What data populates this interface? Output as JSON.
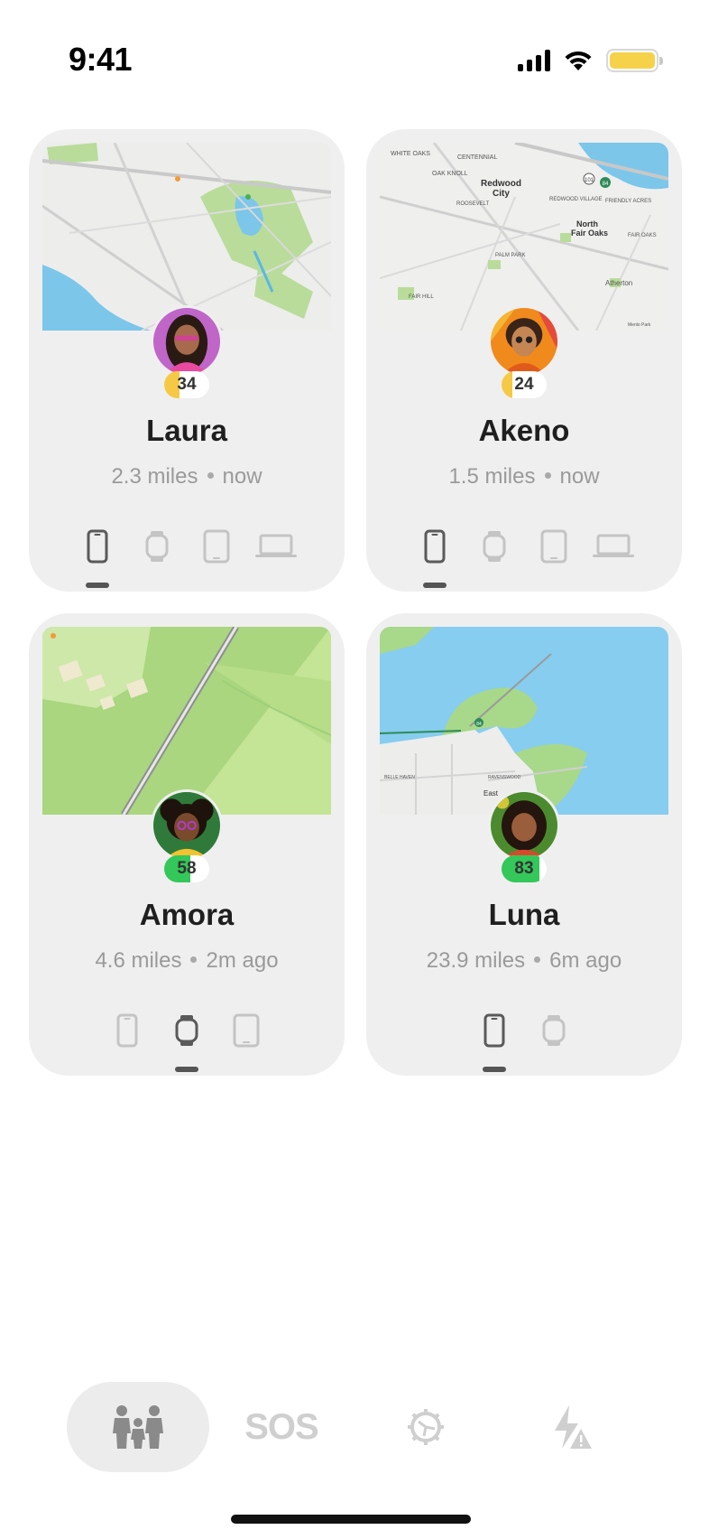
{
  "status_bar": {
    "time": "9:41"
  },
  "people": [
    {
      "name": "Laura",
      "distance": "2.3 miles",
      "last_seen": "now",
      "battery": "34",
      "battery_level": 0.34,
      "battery_color": "#f5c945",
      "map": "urban-bay",
      "avatar_bg": "#c066c8",
      "skin": "#a86a4c",
      "hair": "#2a1a14",
      "shirt": "#e94aa0",
      "devices": [
        {
          "icon": "phone-icon",
          "active": true
        },
        {
          "icon": "watch-icon",
          "active": false
        },
        {
          "icon": "tablet-icon",
          "active": false
        },
        {
          "icon": "laptop-icon",
          "active": false
        }
      ]
    },
    {
      "name": "Akeno",
      "distance": "1.5 miles",
      "last_seen": "now",
      "battery": "24",
      "battery_level": 0.24,
      "battery_color": "#f5c945",
      "map": "city-grid",
      "avatar_bg": "#f08a1c",
      "skin": "#c68654",
      "hair": "#3a2418",
      "shirt": "#e05a1a",
      "devices": [
        {
          "icon": "phone-icon",
          "active": true
        },
        {
          "icon": "watch-icon",
          "active": false
        },
        {
          "icon": "tablet-icon",
          "active": false
        },
        {
          "icon": "laptop-icon",
          "active": false
        }
      ]
    },
    {
      "name": "Amora",
      "distance": "4.6 miles",
      "last_seen": "2m ago",
      "battery": "58",
      "battery_level": 0.58,
      "battery_color": "#34c759",
      "map": "green-rail",
      "avatar_bg": "#2f7a3a",
      "skin": "#7a4a2c",
      "hair": "#1e120c",
      "shirt": "#f2c230",
      "devices": [
        {
          "icon": "phone-icon",
          "active": false
        },
        {
          "icon": "watch-icon",
          "active": true
        },
        {
          "icon": "tablet-icon",
          "active": false
        }
      ]
    },
    {
      "name": "Luna",
      "distance": "23.9 miles",
      "last_seen": "6m ago",
      "battery": "83",
      "battery_level": 0.83,
      "battery_color": "#34c759",
      "map": "bay-wetland",
      "avatar_bg": "#4c8a2e",
      "skin": "#9a5e3c",
      "hair": "#24150e",
      "shirt": "#d9482a",
      "devices": [
        {
          "icon": "phone-icon",
          "active": true
        },
        {
          "icon": "watch-icon",
          "active": false
        }
      ]
    }
  ],
  "map_labels": {
    "akeno": [
      "WHITE OAKS",
      "CENTENNIAL",
      "OAK KNOLL",
      "Redwood",
      "City",
      "ROOSEVELT",
      "REDWOOD VILLAGE",
      "FRIENDLY ACRES",
      "North",
      "Fair Oaks",
      "FAIR OAKS",
      "PALM PARK",
      "Atherton",
      "FAIR HILL",
      "Menlo Park",
      "101",
      "84"
    ],
    "luna": [
      "East",
      "BELLE HAVEN",
      "RAVENSWOOD",
      "84"
    ]
  },
  "tabs": [
    {
      "id": "family",
      "icon": "family-icon",
      "active": true
    },
    {
      "id": "sos",
      "label": "SOS",
      "active": false
    },
    {
      "id": "settings",
      "icon": "gear-icon",
      "active": false
    },
    {
      "id": "alerts",
      "icon": "alert-bolt-icon",
      "active": false
    }
  ]
}
